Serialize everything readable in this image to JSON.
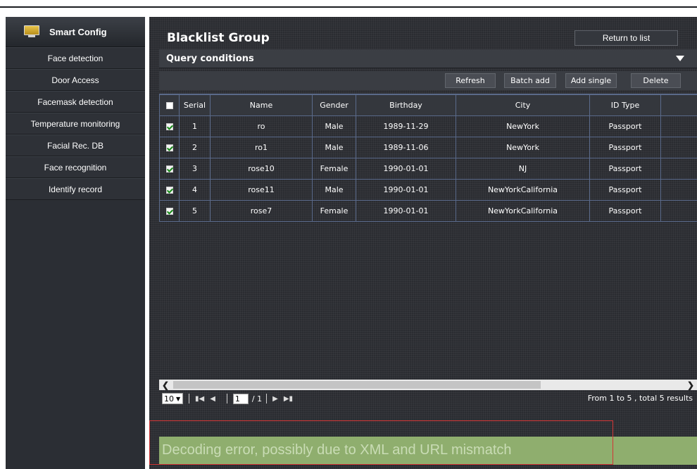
{
  "sidebar": {
    "title": "Smart Config",
    "items": [
      {
        "label": "Face detection"
      },
      {
        "label": "Door Access"
      },
      {
        "label": "Facemask detection"
      },
      {
        "label": "Temperature monitoring"
      },
      {
        "label": "Facial Rec. DB"
      },
      {
        "label": "Face recognition"
      },
      {
        "label": "Identify record"
      }
    ]
  },
  "header": {
    "title": "Blacklist Group",
    "return_label": "Return to list"
  },
  "query": {
    "label": "Query conditions"
  },
  "toolbar": {
    "refresh": "Refresh",
    "batch_add": "Batch add",
    "add_single": "Add single",
    "delete": "Delete"
  },
  "table": {
    "columns": [
      "Serial",
      "Name",
      "Gender",
      "Birthday",
      "City",
      "ID Type"
    ],
    "rows": [
      {
        "checked": true,
        "serial": "1",
        "name": "ro",
        "gender": "Male",
        "birthday": "1989-11-29",
        "city": "NewYork",
        "id_type": "Passport"
      },
      {
        "checked": true,
        "serial": "2",
        "name": "ro1",
        "gender": "Male",
        "birthday": "1989-11-06",
        "city": "NewYork",
        "id_type": "Passport"
      },
      {
        "checked": true,
        "serial": "3",
        "name": "rose10",
        "gender": "Female",
        "birthday": "1990-01-01",
        "city": "NJ",
        "id_type": "Passport"
      },
      {
        "checked": true,
        "serial": "4",
        "name": "rose11",
        "gender": "Male",
        "birthday": "1990-01-01",
        "city": "NewYorkCalifornia",
        "id_type": "Passport"
      },
      {
        "checked": true,
        "serial": "5",
        "name": "rose7",
        "gender": "Female",
        "birthday": "1990-01-01",
        "city": "NewYorkCalifornia",
        "id_type": "Passport"
      }
    ]
  },
  "pager": {
    "page_size": "10",
    "current_page": "1",
    "total_pages": "/ 1",
    "result_text": "From 1 to 5 , total 5 results"
  },
  "error": {
    "message": "Decoding error, possibly due to XML and URL mismatch"
  },
  "colors": {
    "sidebar_bg": "#2b2e34",
    "main_bg": "#2a2c31",
    "grid_border": "#5b6b8c",
    "error_strip": "#8fae6e",
    "error_border": "#d23434"
  }
}
